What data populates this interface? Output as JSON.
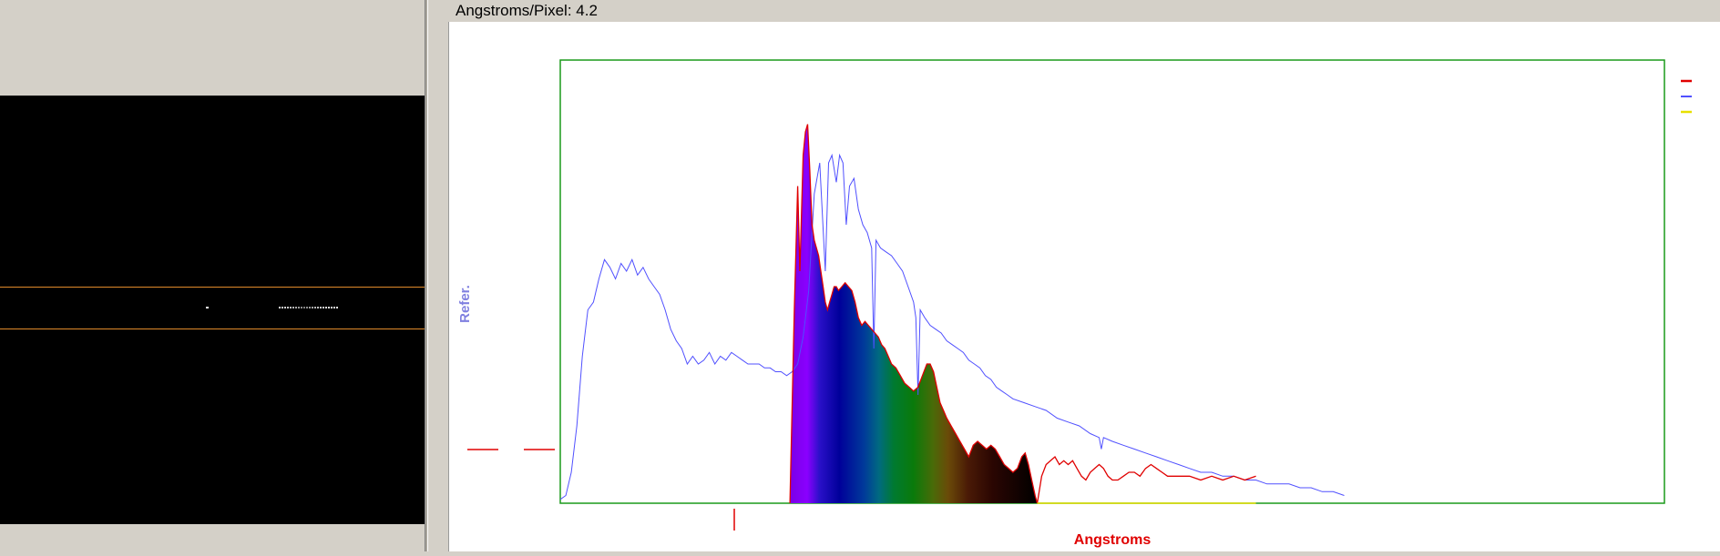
{
  "status": {
    "label": "Angstroms/Pixel:",
    "value": "4.2"
  },
  "colors": {
    "reference_line": "#5050ff",
    "measured_line": "#e00000",
    "baseline": "#e8e000",
    "frame": "#1a9a1a",
    "camera_bg": "#000000",
    "roi_line": "#e08a2a"
  },
  "chart_data": {
    "type": "line",
    "title": "",
    "xlabel": "Angstroms",
    "ylabel": "Refer.",
    "grid": false,
    "legend_position": "top-right",
    "series": [
      {
        "color": "#5050ff",
        "points": [
          [
            0,
            0.01
          ],
          [
            5,
            0.02
          ],
          [
            10,
            0.08
          ],
          [
            15,
            0.2
          ],
          [
            20,
            0.38
          ],
          [
            25,
            0.5
          ],
          [
            30,
            0.52
          ],
          [
            35,
            0.58
          ],
          [
            40,
            0.63
          ],
          [
            45,
            0.61
          ],
          [
            50,
            0.58
          ],
          [
            55,
            0.62
          ],
          [
            60,
            0.6
          ],
          [
            65,
            0.63
          ],
          [
            70,
            0.59
          ],
          [
            75,
            0.61
          ],
          [
            80,
            0.58
          ],
          [
            85,
            0.56
          ],
          [
            90,
            0.54
          ],
          [
            95,
            0.5
          ],
          [
            100,
            0.45
          ],
          [
            105,
            0.42
          ],
          [
            110,
            0.4
          ],
          [
            115,
            0.36
          ],
          [
            120,
            0.38
          ],
          [
            125,
            0.36
          ],
          [
            130,
            0.37
          ],
          [
            135,
            0.39
          ],
          [
            140,
            0.36
          ],
          [
            145,
            0.38
          ],
          [
            150,
            0.37
          ],
          [
            155,
            0.39
          ],
          [
            160,
            0.38
          ],
          [
            165,
            0.37
          ],
          [
            170,
            0.36
          ],
          [
            175,
            0.36
          ],
          [
            180,
            0.36
          ],
          [
            185,
            0.35
          ],
          [
            190,
            0.35
          ],
          [
            195,
            0.34
          ],
          [
            200,
            0.34
          ],
          [
            205,
            0.33
          ],
          [
            210,
            0.34
          ],
          [
            215,
            0.36
          ],
          [
            220,
            0.43
          ],
          [
            225,
            0.55
          ],
          [
            230,
            0.8
          ],
          [
            235,
            0.88
          ],
          [
            240,
            0.6
          ],
          [
            243,
            0.88
          ],
          [
            246,
            0.9
          ],
          [
            250,
            0.83
          ],
          [
            253,
            0.9
          ],
          [
            256,
            0.88
          ],
          [
            259,
            0.72
          ],
          [
            262,
            0.82
          ],
          [
            266,
            0.84
          ],
          [
            270,
            0.76
          ],
          [
            274,
            0.72
          ],
          [
            278,
            0.7
          ],
          [
            282,
            0.66
          ],
          [
            284,
            0.4
          ],
          [
            286,
            0.68
          ],
          [
            290,
            0.66
          ],
          [
            295,
            0.65
          ],
          [
            300,
            0.64
          ],
          [
            305,
            0.62
          ],
          [
            310,
            0.6
          ],
          [
            315,
            0.56
          ],
          [
            320,
            0.52
          ],
          [
            322,
            0.48
          ],
          [
            324,
            0.28
          ],
          [
            326,
            0.5
          ],
          [
            330,
            0.48
          ],
          [
            335,
            0.46
          ],
          [
            340,
            0.45
          ],
          [
            345,
            0.44
          ],
          [
            350,
            0.42
          ],
          [
            355,
            0.41
          ],
          [
            360,
            0.4
          ],
          [
            365,
            0.39
          ],
          [
            370,
            0.37
          ],
          [
            375,
            0.36
          ],
          [
            380,
            0.35
          ],
          [
            385,
            0.33
          ],
          [
            390,
            0.32
          ],
          [
            395,
            0.3
          ],
          [
            400,
            0.29
          ],
          [
            405,
            0.28
          ],
          [
            410,
            0.27
          ],
          [
            420,
            0.26
          ],
          [
            430,
            0.25
          ],
          [
            440,
            0.24
          ],
          [
            450,
            0.22
          ],
          [
            460,
            0.21
          ],
          [
            470,
            0.2
          ],
          [
            480,
            0.18
          ],
          [
            488,
            0.17
          ],
          [
            490,
            0.14
          ],
          [
            492,
            0.17
          ],
          [
            500,
            0.16
          ],
          [
            510,
            0.15
          ],
          [
            520,
            0.14
          ],
          [
            530,
            0.13
          ],
          [
            540,
            0.12
          ],
          [
            550,
            0.11
          ],
          [
            560,
            0.1
          ],
          [
            570,
            0.09
          ],
          [
            580,
            0.08
          ],
          [
            590,
            0.08
          ],
          [
            600,
            0.07
          ],
          [
            610,
            0.07
          ],
          [
            620,
            0.06
          ],
          [
            630,
            0.06
          ],
          [
            640,
            0.05
          ],
          [
            650,
            0.05
          ],
          [
            660,
            0.05
          ],
          [
            670,
            0.04
          ],
          [
            680,
            0.04
          ],
          [
            690,
            0.03
          ],
          [
            700,
            0.03
          ],
          [
            710,
            0.02
          ]
        ]
      },
      {
        "color": "#e00000",
        "points": [
          [
            208,
            0.0
          ],
          [
            212,
            0.5
          ],
          [
            215,
            0.82
          ],
          [
            217,
            0.6
          ],
          [
            220,
            0.9
          ],
          [
            222,
            0.96
          ],
          [
            224,
            0.98
          ],
          [
            226,
            0.86
          ],
          [
            228,
            0.72
          ],
          [
            230,
            0.68
          ],
          [
            232,
            0.66
          ],
          [
            234,
            0.64
          ],
          [
            236,
            0.6
          ],
          [
            238,
            0.56
          ],
          [
            240,
            0.52
          ],
          [
            242,
            0.5
          ],
          [
            244,
            0.52
          ],
          [
            246,
            0.54
          ],
          [
            248,
            0.56
          ],
          [
            250,
            0.56
          ],
          [
            252,
            0.55
          ],
          [
            255,
            0.56
          ],
          [
            258,
            0.57
          ],
          [
            261,
            0.56
          ],
          [
            264,
            0.55
          ],
          [
            267,
            0.52
          ],
          [
            270,
            0.48
          ],
          [
            273,
            0.46
          ],
          [
            276,
            0.47
          ],
          [
            279,
            0.46
          ],
          [
            282,
            0.45
          ],
          [
            285,
            0.44
          ],
          [
            288,
            0.43
          ],
          [
            291,
            0.41
          ],
          [
            294,
            0.4
          ],
          [
            297,
            0.38
          ],
          [
            300,
            0.36
          ],
          [
            304,
            0.35
          ],
          [
            308,
            0.33
          ],
          [
            312,
            0.31
          ],
          [
            316,
            0.3
          ],
          [
            320,
            0.29
          ],
          [
            324,
            0.3
          ],
          [
            328,
            0.33
          ],
          [
            332,
            0.36
          ],
          [
            335,
            0.36
          ],
          [
            338,
            0.34
          ],
          [
            341,
            0.3
          ],
          [
            344,
            0.26
          ],
          [
            347,
            0.24
          ],
          [
            350,
            0.22
          ],
          [
            354,
            0.2
          ],
          [
            358,
            0.18
          ],
          [
            362,
            0.16
          ],
          [
            366,
            0.14
          ],
          [
            370,
            0.12
          ],
          [
            374,
            0.15
          ],
          [
            378,
            0.16
          ],
          [
            382,
            0.15
          ],
          [
            386,
            0.14
          ],
          [
            390,
            0.15
          ],
          [
            394,
            0.14
          ],
          [
            398,
            0.12
          ],
          [
            402,
            0.1
          ],
          [
            406,
            0.09
          ],
          [
            410,
            0.08
          ],
          [
            414,
            0.09
          ],
          [
            418,
            0.12
          ],
          [
            421,
            0.13
          ],
          [
            424,
            0.1
          ],
          [
            427,
            0.06
          ],
          [
            430,
            0.02
          ],
          [
            432,
            0.0
          ],
          [
            436,
            0.07
          ],
          [
            440,
            0.1
          ],
          [
            444,
            0.11
          ],
          [
            448,
            0.12
          ],
          [
            452,
            0.1
          ],
          [
            456,
            0.11
          ],
          [
            460,
            0.1
          ],
          [
            464,
            0.11
          ],
          [
            468,
            0.09
          ],
          [
            472,
            0.07
          ],
          [
            476,
            0.06
          ],
          [
            480,
            0.08
          ],
          [
            484,
            0.09
          ],
          [
            488,
            0.1
          ],
          [
            492,
            0.09
          ],
          [
            496,
            0.07
          ],
          [
            500,
            0.06
          ],
          [
            505,
            0.06
          ],
          [
            510,
            0.07
          ],
          [
            515,
            0.08
          ],
          [
            520,
            0.08
          ],
          [
            525,
            0.07
          ],
          [
            530,
            0.09
          ],
          [
            535,
            0.1
          ],
          [
            540,
            0.09
          ],
          [
            545,
            0.08
          ],
          [
            550,
            0.07
          ],
          [
            560,
            0.07
          ],
          [
            570,
            0.07
          ],
          [
            580,
            0.06
          ],
          [
            590,
            0.07
          ],
          [
            600,
            0.06
          ],
          [
            610,
            0.07
          ],
          [
            620,
            0.06
          ],
          [
            630,
            0.07
          ]
        ]
      },
      {
        "color": "#e8e000",
        "points": [
          [
            432,
            0.0
          ],
          [
            630,
            0.0
          ]
        ]
      }
    ]
  }
}
